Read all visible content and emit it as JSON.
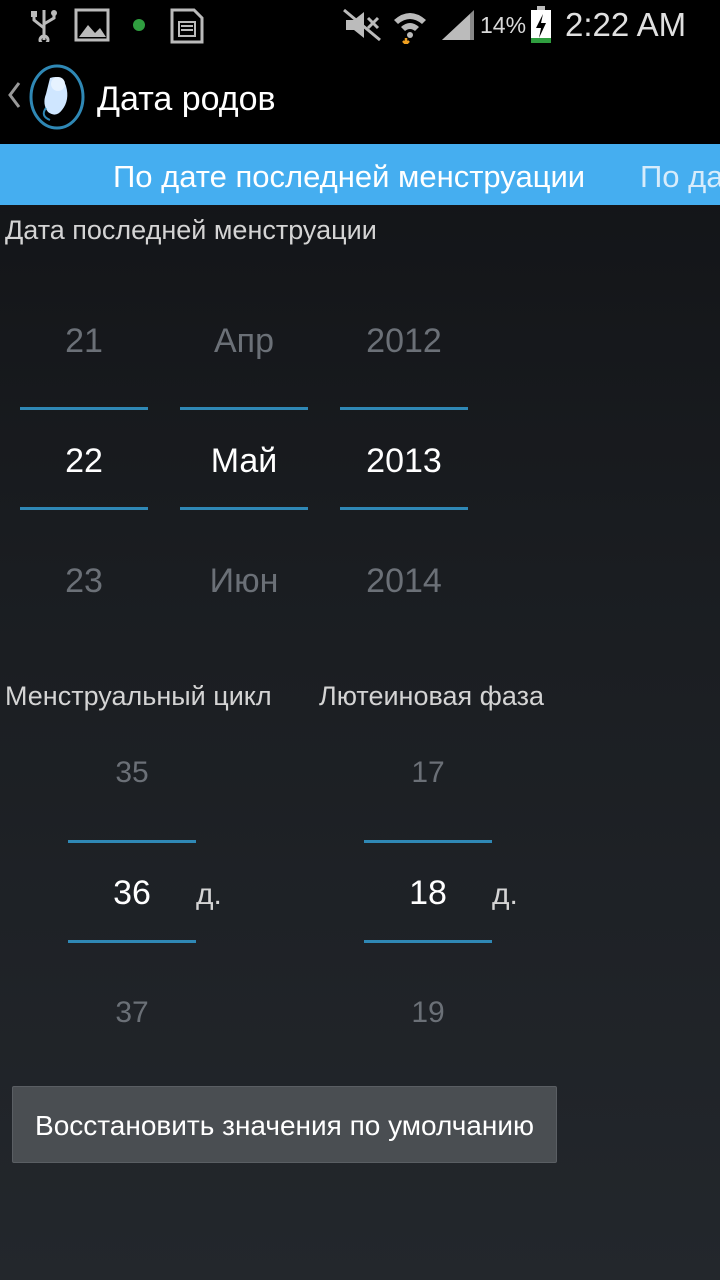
{
  "status_bar": {
    "battery": "14%",
    "time": "2:22 AM",
    "icons": [
      "usb-icon",
      "gallery-icon",
      "notification-dot-icon",
      "sd-card-icon",
      "mute-icon",
      "wifi-icon",
      "signal-icon",
      "battery-charging-icon"
    ]
  },
  "action_bar": {
    "title": "Дата родов",
    "icons": [
      "back-chevron-icon",
      "app-logo-fetus-icon"
    ]
  },
  "tabs": [
    {
      "label": "По дате последней менструации"
    },
    {
      "label": "По да"
    }
  ],
  "date_section": {
    "label": "Дата последней менструации",
    "day": {
      "prev": "21",
      "value": "22",
      "next": "23"
    },
    "month": {
      "prev": "Апр",
      "value": "Май",
      "next": "Июн"
    },
    "year": {
      "prev": "2012",
      "value": "2013",
      "next": "2014"
    }
  },
  "cycle": {
    "label": "Менструальный цикл",
    "prev": "35",
    "value": "36",
    "next": "37",
    "unit": "д."
  },
  "luteal": {
    "label": "Лютеиновая фаза",
    "prev": "17",
    "value": "18",
    "next": "19",
    "unit": "д."
  },
  "reset_button": {
    "label": "Восстановить значения по умолчанию"
  },
  "colors": {
    "accent": "#45aef0",
    "picker_line": "#2f88b5",
    "button": "#4a4e52"
  }
}
